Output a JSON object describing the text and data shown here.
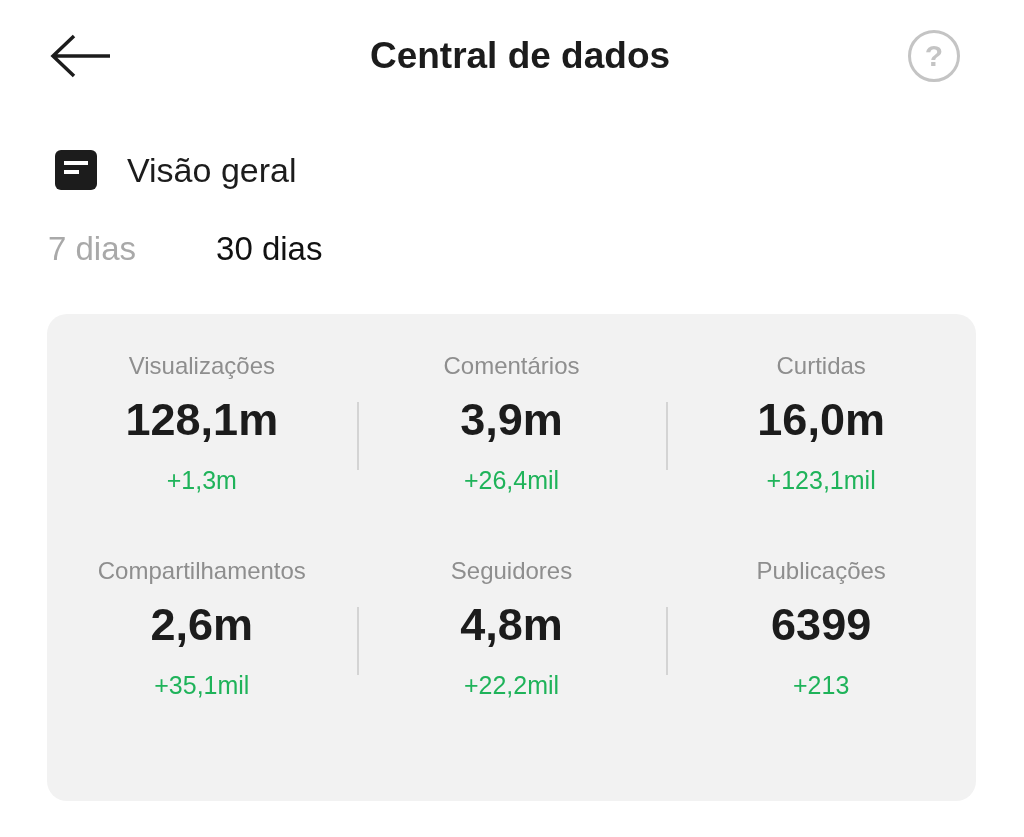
{
  "header": {
    "title": "Central de dados",
    "help": "?"
  },
  "section": {
    "title": "Visão geral"
  },
  "tabs": [
    {
      "label": "7 dias",
      "selected": false
    },
    {
      "label": "30 dias",
      "selected": true
    }
  ],
  "metrics": [
    {
      "label": "Visualizações",
      "value": "128,1m",
      "change": "+1,3m"
    },
    {
      "label": "Comentários",
      "value": "3,9m",
      "change": "+26,4mil"
    },
    {
      "label": "Curtidas",
      "value": "16,0m",
      "change": "+123,1mil"
    },
    {
      "label": "Compartilhamentos",
      "value": "2,6m",
      "change": "+35,1mil"
    },
    {
      "label": "Seguidores",
      "value": "4,8m",
      "change": "+22,2mil"
    },
    {
      "label": "Publicações",
      "value": "6399",
      "change": "+213"
    }
  ]
}
